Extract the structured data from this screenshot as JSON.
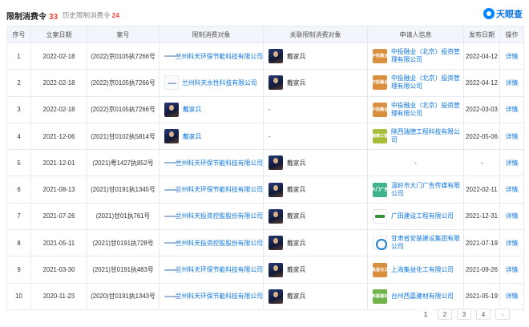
{
  "header": {
    "tab_main": "限制消费令",
    "tab_main_count": "33",
    "tab_history": "历史限制消费令",
    "tab_history_count": "24",
    "brand": "天眼查"
  },
  "columns": [
    "序号",
    "立案日期",
    "案号",
    "限制消费对象",
    "关联限制消费对象",
    "申请人信息",
    "发布日期",
    "操作"
  ],
  "rows": [
    {
      "no": "1",
      "date": "2022-02-18",
      "case": "(2022)京0105执7266号",
      "target_logo": "white",
      "target": "兰州科天环保节能科技有限公司",
      "related": "戴家兵",
      "related_logo": "avatar",
      "app_logo": "tile",
      "app_logo_text": "中投融业",
      "app_color": "#d98f3e",
      "applicant": "中投融业（北京）投资管理有限公司",
      "pub": "2022-04-12",
      "op": "详情"
    },
    {
      "no": "2",
      "date": "2022-02-18",
      "case": "(2022)京0105执7266号",
      "target_logo": "white-sq",
      "target": "兰州科天水性科技有限公司",
      "related": "戴家兵",
      "related_logo": "avatar",
      "app_logo": "tile",
      "app_logo_text": "中投融业",
      "app_color": "#d98f3e",
      "applicant": "中投融业（北京）投资管理有限公司",
      "pub": "2022-04-12",
      "op": "详情"
    },
    {
      "no": "3",
      "date": "2022-02-18",
      "case": "(2022)京0105执7266号",
      "target_logo": "avatar",
      "target": "戴家兵",
      "related": "-",
      "related_logo": "none",
      "app_logo": "tile",
      "app_logo_text": "中投融业",
      "app_color": "#d98f3e",
      "applicant": "中投融业（北京）投资管理有限公司",
      "pub": "2022-03-03",
      "op": "详情"
    },
    {
      "no": "4",
      "date": "2021-12-06",
      "case": "(2021)甘0102执5814号",
      "target_logo": "avatar",
      "target": "戴家兵",
      "related": "-",
      "related_logo": "none",
      "app_logo": "tile",
      "app_logo_text": "瑞德工程",
      "app_color": "#a7bd3a",
      "applicant": "陕西瑞德工程科技有限公司",
      "pub": "2022-05-06",
      "op": "详情"
    },
    {
      "no": "5",
      "date": "2021-12-01",
      "case": "(2021)粤1427执852号",
      "target_logo": "white",
      "target": "兰州科天环保节能科技有限公司",
      "related": "戴家兵",
      "related_logo": "avatar",
      "app_logo": "none",
      "app_logo_text": "",
      "app_color": "",
      "applicant": "-",
      "pub": "-",
      "op": "详情"
    },
    {
      "no": "6",
      "date": "2021-08-13",
      "case": "(2021)甘0191执1345号",
      "target_logo": "white",
      "target": "兰州科天环保节能科技有限公司",
      "related": "戴家兵",
      "related_logo": "avatar",
      "app_logo": "tile",
      "app_logo_text": "大门广告",
      "app_color": "#3fb38d",
      "applicant": "温岭市大门广告传媒有限公司",
      "pub": "2022-02-11",
      "op": "详情"
    },
    {
      "no": "7",
      "date": "2021-07-26",
      "case": "(2021)甘01执761号",
      "target_logo": "white",
      "target": "兰州科天投资控股股份有限公司",
      "related": "戴家兵",
      "related_logo": "avatar",
      "app_logo": "green",
      "app_logo_text": "",
      "app_color": "",
      "applicant": "广田建设工程有限公司",
      "pub": "2021-12-31",
      "op": "详情"
    },
    {
      "no": "8",
      "date": "2021-05-11",
      "case": "(2021)甘0191执728号",
      "target_logo": "white",
      "target": "兰州科天投资控股股份有限公司",
      "related": "戴家兵",
      "related_logo": "avatar",
      "app_logo": "blue",
      "app_logo_text": "",
      "app_color": "",
      "applicant": "甘肃省安装建设集团有限公司",
      "pub": "2021-07-19",
      "op": "详情"
    },
    {
      "no": "9",
      "date": "2021-03-30",
      "case": "(2021)甘0191执483号",
      "target_logo": "white",
      "target": "兰州科天环保节能科技有限公司",
      "related": "戴家兵",
      "related_logo": "avatar",
      "app_logo": "tile",
      "app_logo_text": "集益化工",
      "app_color": "#d98f3e",
      "applicant": "上海集益化工有限公司",
      "pub": "2021-09-26",
      "op": "详情"
    },
    {
      "no": "10",
      "date": "2020-11-23",
      "case": "(2020)甘0191执1343号",
      "target_logo": "white",
      "target": "兰州科天环保节能科技有限公司",
      "related": "戴家兵",
      "related_logo": "avatar",
      "app_logo": "tile",
      "app_logo_text": "西嘉建材",
      "app_color": "#6fb34a",
      "applicant": "台州西嘉建材有限公司",
      "pub": "2021-05-19",
      "op": "详情"
    }
  ],
  "pagination": {
    "pages": [
      "1",
      "2",
      "3",
      "4"
    ],
    "current": "1",
    "next": "›"
  }
}
